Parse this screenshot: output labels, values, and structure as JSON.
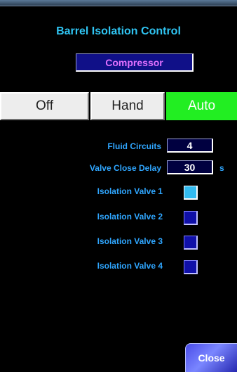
{
  "window": {
    "title": "Barrel Isolation Control",
    "equipment": "Compressor"
  },
  "mode": {
    "options": [
      {
        "label": "Off",
        "active": false
      },
      {
        "label": "Hand",
        "active": false
      },
      {
        "label": "Auto",
        "active": true
      }
    ],
    "active_color": "#22ee22"
  },
  "settings": {
    "fluid_circuits": {
      "label": "Fluid Circuits",
      "value": "4"
    },
    "valve_close_delay": {
      "label": "Valve Close Delay",
      "value": "30",
      "unit": "s"
    }
  },
  "valves": [
    {
      "label": "Isolation Valve 1",
      "state": "open"
    },
    {
      "label": "Isolation Valve 2",
      "state": "closed"
    },
    {
      "label": "Isolation Valve 3",
      "state": "closed"
    },
    {
      "label": "Isolation Valve 4",
      "state": "closed"
    }
  ],
  "colors": {
    "label": "#2fa6ff",
    "title": "#2fc4f2",
    "valve_open": "#33bbf0",
    "valve_closed": "#1010a8"
  },
  "close_label": "Close"
}
